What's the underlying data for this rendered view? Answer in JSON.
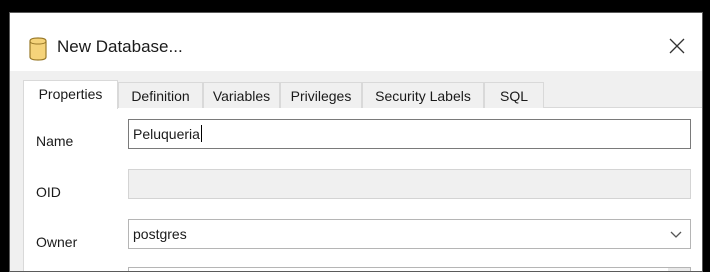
{
  "window": {
    "title": "New Database...",
    "close_glyph": "✕",
    "icon": "database-icon"
  },
  "tabs": [
    {
      "label": "Properties",
      "active": true
    },
    {
      "label": "Definition",
      "active": false
    },
    {
      "label": "Variables",
      "active": false
    },
    {
      "label": "Privileges",
      "active": false
    },
    {
      "label": "Security Labels",
      "active": false
    },
    {
      "label": "SQL",
      "active": false
    }
  ],
  "form": {
    "name": {
      "label": "Name",
      "value": "Peluqueria"
    },
    "oid": {
      "label": "OID",
      "value": ""
    },
    "owner": {
      "label": "Owner",
      "value": "postgres"
    }
  },
  "colors": {
    "icon_fill": "#f5d37a",
    "icon_stroke": "#9a7a2a"
  }
}
